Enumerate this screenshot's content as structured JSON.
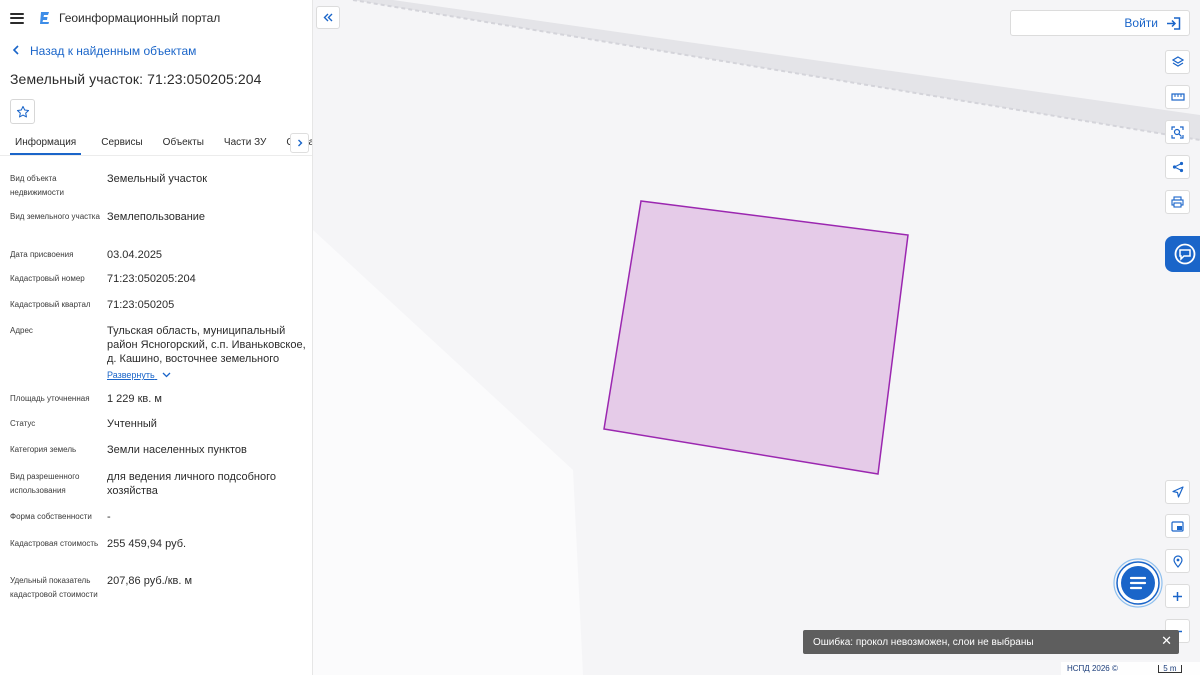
{
  "header": {
    "app_title": "Геоинформационный портал"
  },
  "back_link": "Назад к найденным объектам",
  "object_title": "Земельный участок: 71:23:050205:204",
  "tabs": [
    {
      "label": "Информация",
      "active": true
    },
    {
      "label": "Сервисы",
      "active": false
    },
    {
      "label": "Объекты",
      "active": false
    },
    {
      "label": "Части ЗУ",
      "active": false
    },
    {
      "label": "Состав",
      "active": false
    }
  ],
  "properties": [
    {
      "label": "Вид объекта недвижимости",
      "value": "Земельный участок"
    },
    {
      "label": "Вид земельного участка",
      "value": "Землепользование"
    },
    {
      "label": "Дата присвоения",
      "value": "03.04.2025"
    },
    {
      "label": "Кадастровый номер",
      "value": "71:23:050205:204"
    },
    {
      "label": "Кадастровый квартал",
      "value": "71:23:050205"
    },
    {
      "label": "Адрес",
      "value": "Тульская область, муниципальный район Ясногорский, с.п. Иваньковское, д. Кашино, восточнее земельного",
      "expand": "Развернуть"
    },
    {
      "label": "Площадь уточненная",
      "value": "1 229 кв. м"
    },
    {
      "label": "Статус",
      "value": "Учтенный"
    },
    {
      "label": "Категория земель",
      "value": "Земли населенных пунктов"
    },
    {
      "label": "Вид разрешенного использования",
      "value": "для ведения личного подсобного хозяйства"
    },
    {
      "label": "Форма собственности",
      "value": "-"
    },
    {
      "label": "Кадастровая стоимость",
      "value": "255 459,94 руб."
    },
    {
      "label": "Удельный показатель кадастровой стоимости",
      "value": "207,86 руб./кв. м"
    }
  ],
  "map": {
    "login_label": "Войти",
    "toast_message": "Ошибка: прокол невозможен, слои не выбраны",
    "copyright": "НСПД 2026 ©",
    "scale_label": "5 m",
    "parcel_fill": "#e5cbe8",
    "parcel_stroke": "#9b27b0"
  },
  "colors": {
    "accent": "#1a65c9"
  }
}
